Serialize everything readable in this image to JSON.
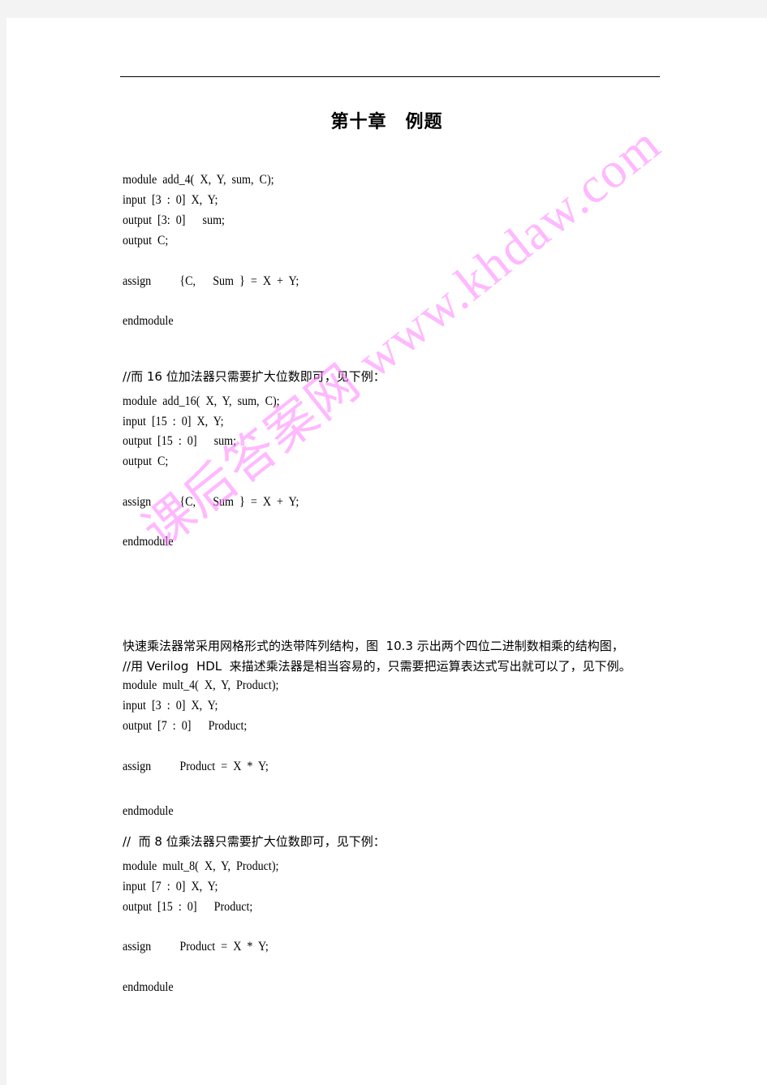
{
  "document": {
    "title": "第十章　例题",
    "watermark": "课后答案网 www.khdaw.com",
    "blocks": [
      {
        "id": "add_4",
        "lines": [
          "module  add_4(  X,  Y,  sum,  C);",
          "input  [3  :  0]  X,  Y;",
          "output  [3:  0]      sum;",
          "output  C;",
          "",
          "assign          {C,      Sum  }  =  X  +  Y;",
          "",
          "endmodule"
        ]
      },
      {
        "id": "add_16",
        "comment": "//而 16 位加法器只需要扩大位数即可，见下例：",
        "lines": [
          "module  add_16(  X,  Y,  sum,  C);",
          "input  [15  :  0]  X,  Y;",
          "output  [15  :  0]      sum;",
          "output  C;",
          "",
          "assign          {C,      Sum  }  =  X  +  Y;",
          "",
          "endmodule"
        ]
      },
      {
        "id": "mult_4",
        "paragraph": [
          "快速乘法器常采用网格形式的迭带阵列结构，图  10.3 示出两个四位二进制数相乘的结构图，",
          "//用 Verilog  HDL  来描述乘法器是相当容易的，只需要把运算表达式写出就可以了，见下例。"
        ],
        "lines": [
          "module  mult_4(  X,  Y,  Product);",
          "input  [3  :  0]  X,  Y;",
          "output  [7  :  0]      Product;",
          "",
          "assign          Product  =  X  *  Y;",
          "",
          "endmodule"
        ]
      },
      {
        "id": "mult_8",
        "comment": "//  而 8 位乘法器只需要扩大位数即可，见下例：",
        "lines": [
          "module  mult_8(  X,  Y,  Product);",
          "input  [7  :  0]  X,  Y;",
          "output  [15  :  0]      Product;",
          "",
          "assign          Product  =  X  *  Y;",
          "",
          "endmodule"
        ]
      }
    ]
  }
}
